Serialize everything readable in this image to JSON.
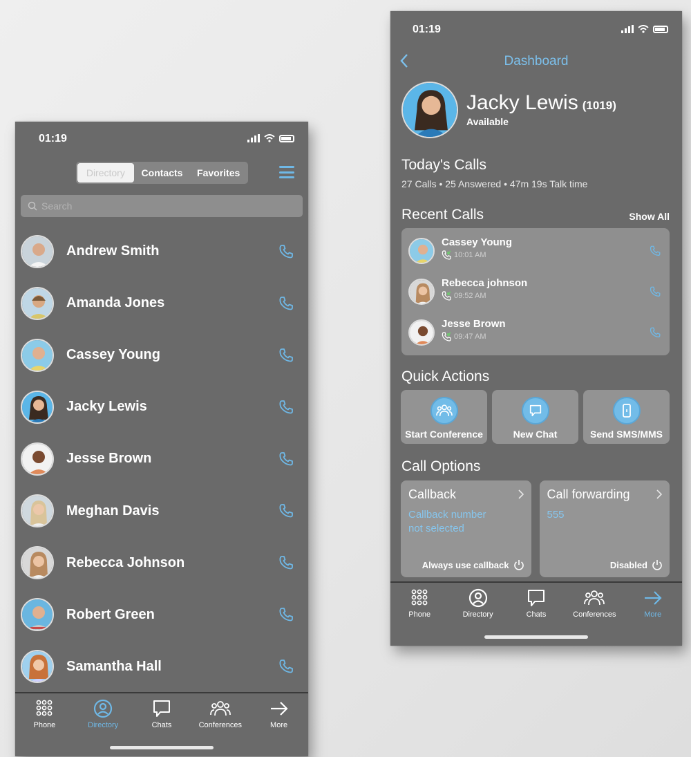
{
  "left_phone": {
    "status_time": "01:19",
    "segments": [
      {
        "label": "Directory",
        "active": true
      },
      {
        "label": "Contacts",
        "active": false
      },
      {
        "label": "Favorites",
        "active": false
      }
    ],
    "search_placeholder": "Search",
    "contacts": [
      {
        "name": "Andrew Smith",
        "avatar_color": "#c9d3da"
      },
      {
        "name": "Amanda Jones",
        "avatar_color": "#d8c66a"
      },
      {
        "name": "Cassey Young",
        "avatar_color": "#e9d56a"
      },
      {
        "name": "Jacky Lewis",
        "avatar_color": "#5bb6e8"
      },
      {
        "name": "Jesse Brown",
        "avatar_color": "#e08a5a"
      },
      {
        "name": "Meghan Davis",
        "avatar_color": "#d8d8d0"
      },
      {
        "name": "Rebecca Johnson",
        "avatar_color": "#e0d8cc"
      },
      {
        "name": "Robert Green",
        "avatar_color": "#6ab6e0"
      },
      {
        "name": "Samantha Hall",
        "avatar_color": "#d0d0ff"
      }
    ],
    "tabs": [
      {
        "label": "Phone",
        "icon": "dialpad-icon",
        "active": false
      },
      {
        "label": "Directory",
        "icon": "user-circle-icon",
        "active": true
      },
      {
        "label": "Chats",
        "icon": "chat-icon",
        "active": false
      },
      {
        "label": "Conferences",
        "icon": "group-icon",
        "active": false
      },
      {
        "label": "More",
        "icon": "arrow-right-icon",
        "active": false
      }
    ]
  },
  "right_phone": {
    "status_time": "01:19",
    "title": "Dashboard",
    "profile": {
      "name": "Jacky Lewis",
      "extension": "(1019)",
      "status": "Available"
    },
    "todays_calls": {
      "title": "Today's Calls",
      "summary": "27 Calls • 25 Answered • 47m  19s Talk time"
    },
    "recent_calls": {
      "title": "Recent Calls",
      "show_all": "Show All",
      "items": [
        {
          "name": "Cassey Young",
          "time": "10:01 AM",
          "avatar_color": "#e9d56a"
        },
        {
          "name": "Rebecca johnson",
          "time": "09:52 AM",
          "avatar_color": "#e0d8cc"
        },
        {
          "name": "Jesse Brown",
          "time": "09:47 AM",
          "avatar_color": "#e08a5a"
        }
      ]
    },
    "quick_actions": {
      "title": "Quick Actions",
      "items": [
        {
          "label": "Start Conference",
          "icon": "group-icon"
        },
        {
          "label": "New Chat",
          "icon": "chat-icon"
        },
        {
          "label": "Send SMS/MMS",
          "icon": "mobile-icon"
        }
      ]
    },
    "call_options": {
      "title": "Call Options",
      "callback": {
        "title": "Callback",
        "value_line1": "Callback number",
        "value_line2": "not selected",
        "footer": "Always use callback"
      },
      "forwarding": {
        "title": "Call forwarding",
        "value_line1": "555",
        "footer": "Disabled"
      }
    },
    "tabs": [
      {
        "label": "Phone",
        "icon": "dialpad-icon",
        "active": false
      },
      {
        "label": "Directory",
        "icon": "user-circle-icon",
        "active": false
      },
      {
        "label": "Chats",
        "icon": "chat-icon",
        "active": false
      },
      {
        "label": "Conferences",
        "icon": "group-icon",
        "active": false
      },
      {
        "label": "More",
        "icon": "arrow-right-icon",
        "active": true
      }
    ]
  },
  "colors": {
    "accent": "#6fb8e6",
    "phone_bg": "#6a6a6a",
    "card_bg": "#8f8f8f"
  }
}
